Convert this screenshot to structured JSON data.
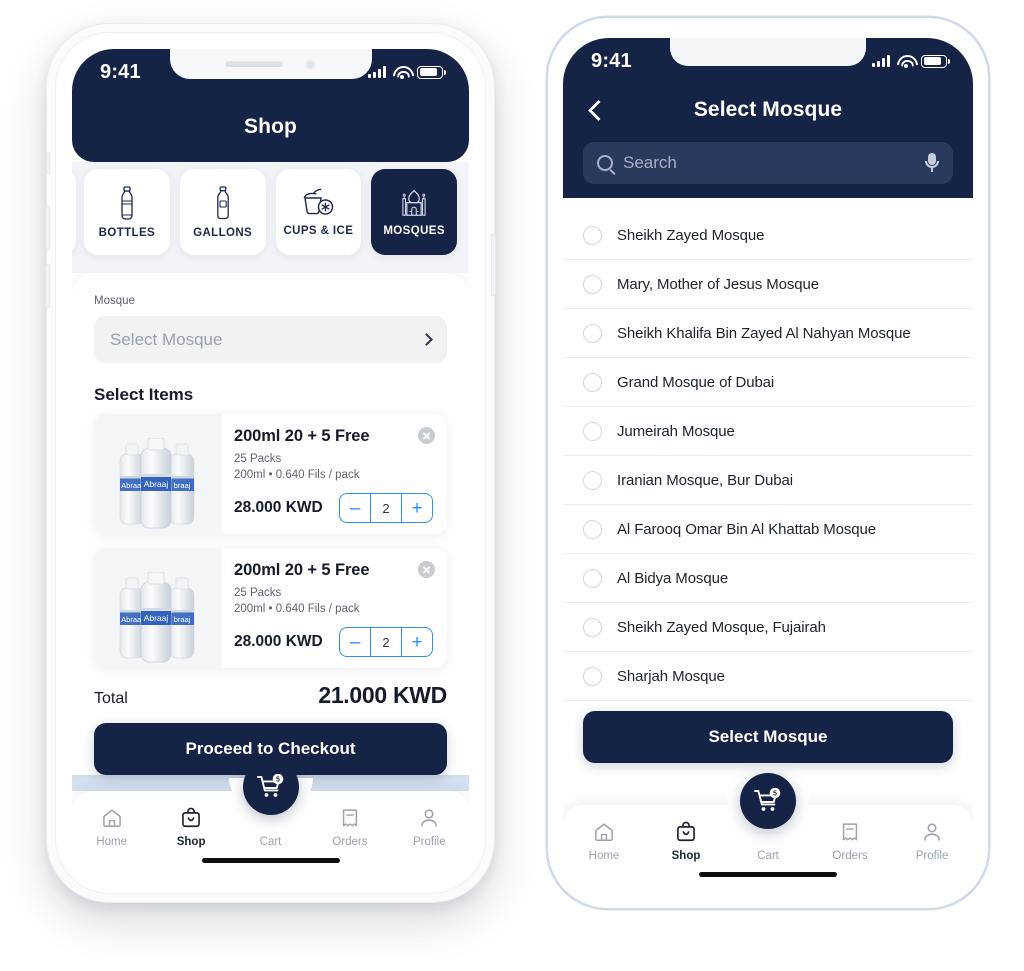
{
  "theme": {
    "navy": "#152346",
    "accent_blue": "#2f8ef4",
    "pale_blue": "#d5e1f0",
    "light_gray": "#f2f4f7"
  },
  "phone_left": {
    "status": {
      "time": "9:41",
      "signal_icon": "cellular-bars-icon",
      "wifi_icon": "wifi-icon",
      "battery_icon": "battery-icon"
    },
    "header": {
      "title": "Shop"
    },
    "categories": [
      {
        "label": "BOTTLES",
        "icon": "bottle-icon",
        "active": false
      },
      {
        "label": "GALLONS",
        "icon": "gallon-icon",
        "active": false
      },
      {
        "label": "CUPS & ICE",
        "icon": "cups-ice-icon",
        "active": false
      },
      {
        "label": "MOSQUES",
        "icon": "mosque-icon",
        "active": true
      }
    ],
    "form": {
      "mosque_label": "Mosque",
      "mosque_placeholder": "Select Mosque",
      "chevron_icon": "chevron-right-icon"
    },
    "items_section_title": "Select Items",
    "products": [
      {
        "title": "200ml 20 + 5 Free",
        "packs": "25 Packs",
        "detail": "200ml  •  0.640 Fils / pack",
        "price": "28.000 KWD",
        "qty": "2",
        "minus": "–",
        "plus": "+",
        "remove_icon": "close-circle-icon",
        "image_alt": "abraaj-water-bottles"
      },
      {
        "title": "200ml 20 + 5 Free",
        "packs": "25 Packs",
        "detail": "200ml  •  0.640 Fils / pack",
        "price": "28.000 KWD",
        "qty": "2",
        "minus": "–",
        "plus": "+",
        "remove_icon": "close-circle-icon",
        "image_alt": "abraaj-water-bottles"
      }
    ],
    "total": {
      "label": "Total",
      "value": "21.000 KWD"
    },
    "checkout_button": "Proceed to Checkout",
    "tabbar": {
      "cart_badge": "5",
      "items": [
        {
          "label": "Home",
          "icon": "home-icon",
          "active": false
        },
        {
          "label": "Shop",
          "icon": "shop-bag-icon",
          "active": true
        },
        {
          "label": "Cart",
          "icon": "cart-icon",
          "active": false
        },
        {
          "label": "Orders",
          "icon": "receipt-icon",
          "active": false
        },
        {
          "label": "Profile",
          "icon": "person-icon",
          "active": false
        }
      ]
    }
  },
  "phone_right": {
    "status": {
      "time": "9:41",
      "signal_icon": "cellular-bars-icon",
      "wifi_icon": "wifi-icon",
      "battery_icon": "battery-icon"
    },
    "header": {
      "title": "Select Mosque",
      "back_icon": "chevron-left-icon"
    },
    "search": {
      "placeholder": "Search",
      "value": "",
      "search_icon": "search-icon",
      "mic_icon": "microphone-icon"
    },
    "mosques": [
      {
        "name": "Sheikh Zayed Mosque",
        "selected": false
      },
      {
        "name": "Mary, Mother of Jesus Mosque",
        "selected": false
      },
      {
        "name": "Sheikh Khalifa Bin Zayed Al Nahyan Mosque",
        "selected": false
      },
      {
        "name": "Grand Mosque of Dubai",
        "selected": false
      },
      {
        "name": "Jumeirah Mosque",
        "selected": false
      },
      {
        "name": "Iranian Mosque, Bur Dubai",
        "selected": false
      },
      {
        "name": "Al Farooq Omar Bin Al Khattab Mosque",
        "selected": false
      },
      {
        "name": "Al Bidya Mosque",
        "selected": false
      },
      {
        "name": "Sheikh Zayed Mosque, Fujairah",
        "selected": false
      },
      {
        "name": "Sharjah Mosque",
        "selected": false
      }
    ],
    "select_button": "Select Mosque",
    "tabbar": {
      "cart_badge": "5",
      "items": [
        {
          "label": "Home",
          "icon": "home-icon",
          "active": false
        },
        {
          "label": "Shop",
          "icon": "shop-bag-icon",
          "active": true
        },
        {
          "label": "Cart",
          "icon": "cart-icon",
          "active": false
        },
        {
          "label": "Orders",
          "icon": "receipt-icon",
          "active": false
        },
        {
          "label": "Profile",
          "icon": "person-icon",
          "active": false
        }
      ]
    }
  }
}
